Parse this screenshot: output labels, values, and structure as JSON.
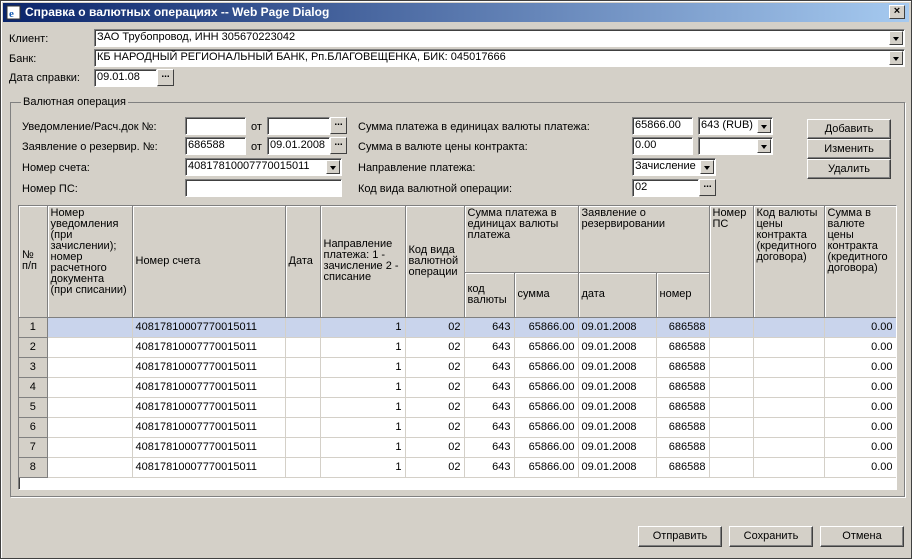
{
  "window": {
    "title": "Справка о валютных операциях -- Web Page Dialog",
    "close": "×"
  },
  "top": {
    "client_label": "Клиент:",
    "client_value": "ЗАО Трубопровод, ИНН 305670223042",
    "bank_label": "Банк:",
    "bank_value": "КБ НАРОДНЫЙ РЕГИОНАЛЬНЫЙ БАНК, Рп.БЛАГОВЕЩЕНКА, БИК: 045017666",
    "date_label": "Дата справки:",
    "date_value": "09.01.08"
  },
  "operation": {
    "group_title": "Валютная операция",
    "notice_label": "Уведомление/Расч.док №:",
    "notice_value": "",
    "notice_from_label": "от",
    "notice_from_value": "",
    "reserve_label": "Заявление о резервир. №:",
    "reserve_value": "686588",
    "reserve_from_label": "от",
    "reserve_from_value": "09.01.2008",
    "account_label": "Номер счета:",
    "account_value": "40817810007770015011",
    "ps_label": "Номер ПС:",
    "ps_value": "",
    "amount_label": "Сумма платежа в единицах валюты платежа:",
    "amount_value": "65866.00",
    "currency_value": "643 (RUB)",
    "contract_amount_label": "Сумма в валюте цены контракта:",
    "contract_amount_value": "0.00",
    "contract_currency_value": "",
    "direction_label": "Направление платежа:",
    "direction_value": "Зачисление",
    "op_code_label": "Код вида валютной операции:",
    "op_code_value": "02",
    "dots": "..."
  },
  "side_buttons": {
    "add": "Добавить",
    "edit": "Изменить",
    "delete": "Удалить"
  },
  "table": {
    "headers": {
      "num": "№ п/п",
      "notice": "Номер уведомления (при зачислении); номер расчетного документа (при списании)",
      "account": "Номер счета",
      "date": "Дата",
      "direction": "Направление платежа: 1 - зачисление 2 - списание",
      "op_code": "Код вида валютной операции",
      "amount_group": "Сумма платежа в единицах валюты платежа",
      "currency_code": "код валюты",
      "amount": "сумма",
      "reserve_group": "Заявление о резервировании",
      "reserve_date": "дата",
      "reserve_number": "номер",
      "ps": "Номер ПС",
      "contract_currency": "Код валюты цены контракта (кредитного договора)",
      "contract_amount": "Сумма в валюте цены контракта (кредитного договора)"
    },
    "rows": [
      {
        "n": "1",
        "notice": "",
        "account": "40817810007770015011",
        "date": "",
        "dir": "1",
        "code": "02",
        "cur": "643",
        "sum": "65866.00",
        "rdate": "09.01.2008",
        "rnum": "686588",
        "ps": "",
        "ccur": "",
        "camount": "0.00"
      },
      {
        "n": "2",
        "notice": "",
        "account": "40817810007770015011",
        "date": "",
        "dir": "1",
        "code": "02",
        "cur": "643",
        "sum": "65866.00",
        "rdate": "09.01.2008",
        "rnum": "686588",
        "ps": "",
        "ccur": "",
        "camount": "0.00"
      },
      {
        "n": "3",
        "notice": "",
        "account": "40817810007770015011",
        "date": "",
        "dir": "1",
        "code": "02",
        "cur": "643",
        "sum": "65866.00",
        "rdate": "09.01.2008",
        "rnum": "686588",
        "ps": "",
        "ccur": "",
        "camount": "0.00"
      },
      {
        "n": "4",
        "notice": "",
        "account": "40817810007770015011",
        "date": "",
        "dir": "1",
        "code": "02",
        "cur": "643",
        "sum": "65866.00",
        "rdate": "09.01.2008",
        "rnum": "686588",
        "ps": "",
        "ccur": "",
        "camount": "0.00"
      },
      {
        "n": "5",
        "notice": "",
        "account": "40817810007770015011",
        "date": "",
        "dir": "1",
        "code": "02",
        "cur": "643",
        "sum": "65866.00",
        "rdate": "09.01.2008",
        "rnum": "686588",
        "ps": "",
        "ccur": "",
        "camount": "0.00"
      },
      {
        "n": "6",
        "notice": "",
        "account": "40817810007770015011",
        "date": "",
        "dir": "1",
        "code": "02",
        "cur": "643",
        "sum": "65866.00",
        "rdate": "09.01.2008",
        "rnum": "686588",
        "ps": "",
        "ccur": "",
        "camount": "0.00"
      },
      {
        "n": "7",
        "notice": "",
        "account": "40817810007770015011",
        "date": "",
        "dir": "1",
        "code": "02",
        "cur": "643",
        "sum": "65866.00",
        "rdate": "09.01.2008",
        "rnum": "686588",
        "ps": "",
        "ccur": "",
        "camount": "0.00"
      },
      {
        "n": "8",
        "notice": "",
        "account": "40817810007770015011",
        "date": "",
        "dir": "1",
        "code": "02",
        "cur": "643",
        "sum": "65866.00",
        "rdate": "09.01.2008",
        "rnum": "686588",
        "ps": "",
        "ccur": "",
        "camount": "0.00"
      }
    ]
  },
  "bottom_buttons": {
    "send": "Отправить",
    "save": "Сохранить",
    "cancel": "Отмена"
  },
  "colors": {
    "titlebar_start": "#0a246a",
    "titlebar_end": "#a6caf0",
    "selected_row": "#c9d4ec",
    "face": "#d4d0c8"
  }
}
